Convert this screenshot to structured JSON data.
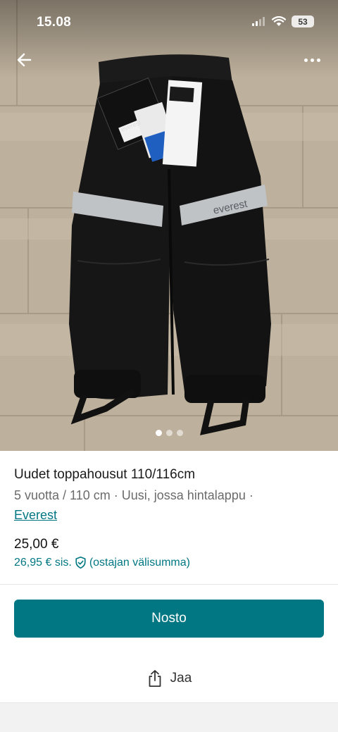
{
  "status_bar": {
    "time": "15.08",
    "battery": "53"
  },
  "gallery": {
    "image_count": 3,
    "active_index": 0,
    "tag_text": "everest"
  },
  "item": {
    "title": "Uudet toppahousut 110/116cm",
    "meta": "5 vuotta / 110 cm · Uusi, jossa hintalappu ·",
    "brand": "Everest"
  },
  "pricing": {
    "price": "25,00 €",
    "total": "26,95 € sis.",
    "total_note": "(ostajan välisumma)"
  },
  "actions": {
    "primary_label": "Nosto",
    "share_label": "Jaa"
  },
  "colors": {
    "accent": "#007782",
    "photo_floor": "#c2b5a2",
    "pants": "#141414"
  },
  "icons": {
    "back": "arrow-left-icon",
    "more": "more-horizontal-icon",
    "shield": "shield-check-icon",
    "share": "share-icon"
  }
}
